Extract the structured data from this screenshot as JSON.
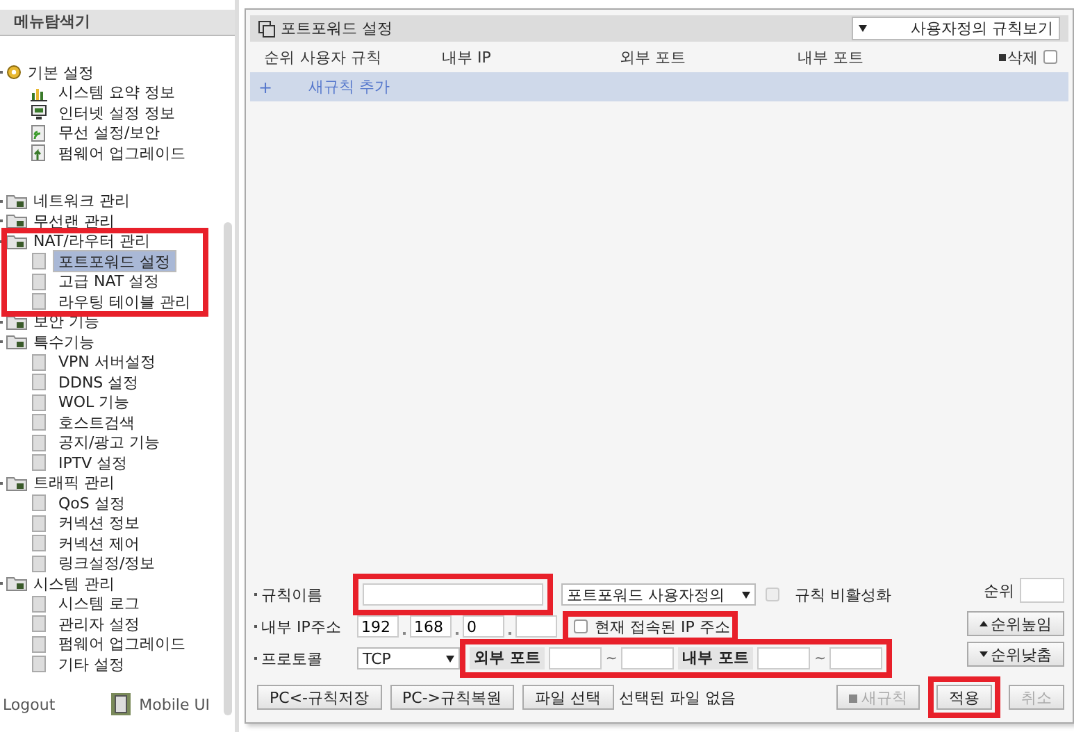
{
  "sidebar": {
    "title": "메뉴탐색기",
    "groups": [
      {
        "label": "기본 설정",
        "children": [
          {
            "label": "시스템 요약 정보",
            "selected": false
          },
          {
            "label": "인터넷 설정 정보",
            "selected": false
          },
          {
            "label": "무선 설정/보안",
            "selected": false
          },
          {
            "label": "펌웨어 업그레이드",
            "selected": false
          }
        ]
      },
      {
        "label": "네트워크 관리"
      },
      {
        "label": "무선랜 관리"
      },
      {
        "label": "NAT/라우터 관리",
        "highlighted": true,
        "children": [
          {
            "label": "포트포워드 설정",
            "selected": true
          },
          {
            "label": "고급 NAT 설정",
            "selected": false
          },
          {
            "label": "라우팅 테이블 관리",
            "selected": false
          }
        ]
      },
      {
        "label": "보안 기능"
      },
      {
        "label": "특수기능",
        "children": [
          {
            "label": "VPN 서버설정",
            "selected": false
          },
          {
            "label": "DDNS 설정",
            "selected": false
          },
          {
            "label": "WOL 기능",
            "selected": false
          },
          {
            "label": "호스트검색",
            "selected": false
          },
          {
            "label": "공지/광고 기능",
            "selected": false
          },
          {
            "label": "IPTV 설정",
            "selected": false
          }
        ]
      },
      {
        "label": "트래픽 관리",
        "children": [
          {
            "label": "QoS 설정",
            "selected": false
          },
          {
            "label": "커넥션 정보",
            "selected": false
          },
          {
            "label": "커넥션 제어",
            "selected": false
          },
          {
            "label": "링크설정/정보",
            "selected": false
          }
        ]
      },
      {
        "label": "시스템 관리",
        "children": [
          {
            "label": "시스템 로그",
            "selected": false
          },
          {
            "label": "관리자 설정",
            "selected": false
          },
          {
            "label": "펌웨어 업그레이드",
            "selected": false
          },
          {
            "label": "기타 설정",
            "selected": false
          }
        ]
      }
    ],
    "logout": "Logout",
    "mobile": "Mobile UI"
  },
  "panel": {
    "title": "포트포워드 설정",
    "view_select": "사용자정의 규칙보기",
    "columns": [
      "순위",
      "사용자 규칙",
      "내부 IP",
      "외부 포트",
      "내부 포트"
    ],
    "delete_label": "삭제",
    "delete_all_checked": false,
    "add_row": {
      "plus": "+",
      "label": "새규칙 추가"
    }
  },
  "form": {
    "rule_name": {
      "label": "규칙이름",
      "highlighted": true
    },
    "rule_type": "포트포워드 사용자정의",
    "disable": {
      "label": "규칙 비활성화",
      "checked": false
    },
    "ip": {
      "label": "내부 IP주소",
      "octets": [
        "192",
        "168",
        "0"
      ]
    },
    "current_ip": {
      "label": "현재 접속된 IP 주소",
      "checked": false,
      "highlighted": true
    },
    "protocol": {
      "label": "프로토콜",
      "value": "TCP"
    },
    "ports": {
      "external": "외부 포트",
      "internal": "내부 포트",
      "tilde": "~",
      "highlighted": true
    },
    "order": {
      "label": "순위"
    },
    "up": "순위높임",
    "down": "순위낮춤"
  },
  "buttons": [
    "PC<-규칙저장",
    "PC->규칙복원",
    "파일 선택"
  ],
  "file_status": "선택된 파일 없음",
  "actions": [
    {
      "label": "새규칙",
      "kind": "new",
      "disabled": true
    },
    {
      "label": "적용",
      "kind": "normal",
      "disabled": false,
      "highlighted": true
    },
    {
      "label": "취소",
      "kind": "normal",
      "disabled": true
    }
  ]
}
